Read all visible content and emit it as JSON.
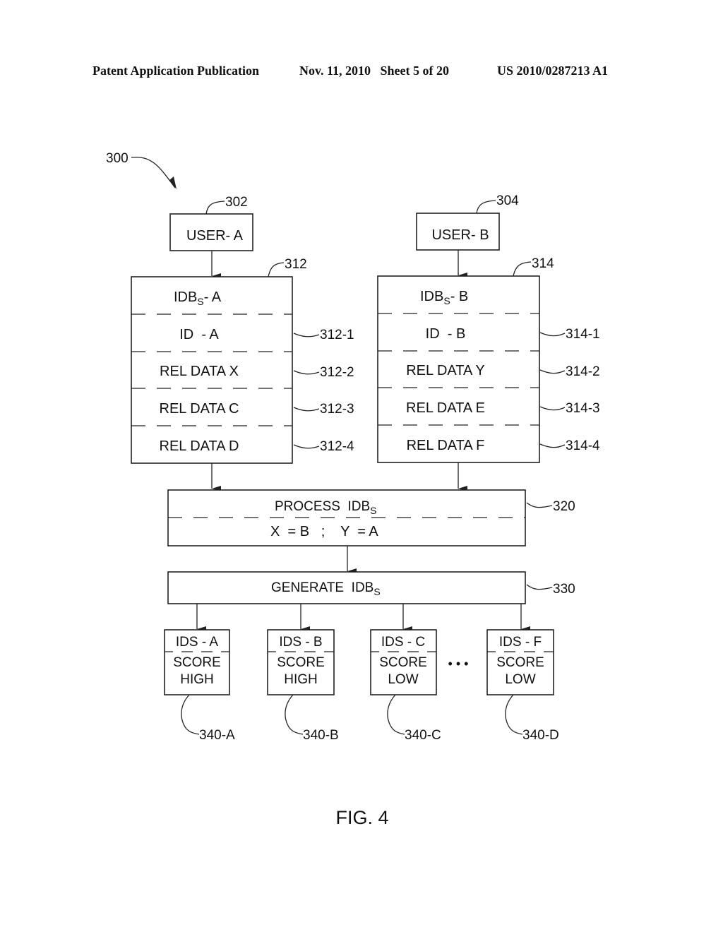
{
  "header": {
    "publication": "Patent Application Publication",
    "date_sheet": "Nov. 11, 2010   Sheet 5 of 20",
    "patent_number": "US 2010/0287213 A1"
  },
  "figure": {
    "caption": "FIG. 4",
    "overall_ref": "300",
    "users": [
      {
        "ref": "302",
        "label": "USER- A"
      },
      {
        "ref": "304",
        "label": "USER- B"
      }
    ],
    "idbs": [
      {
        "ref": "312",
        "title": "IDB",
        "title_sub": "S",
        "title_suffix": "- A",
        "rows": [
          {
            "label": "ID  - A",
            "ref": "312-1"
          },
          {
            "label": "REL DATA X",
            "ref": "312-2"
          },
          {
            "label": "REL DATA C",
            "ref": "312-3"
          },
          {
            "label": "REL DATA D",
            "ref": "312-4"
          }
        ]
      },
      {
        "ref": "314",
        "title": "IDB",
        "title_sub": "S",
        "title_suffix": "- B",
        "rows": [
          {
            "label": "ID  - B",
            "ref": "314-1"
          },
          {
            "label": "REL DATA Y",
            "ref": "314-2"
          },
          {
            "label": "REL DATA E",
            "ref": "314-3"
          },
          {
            "label": "REL DATA F",
            "ref": "314-4"
          }
        ]
      }
    ],
    "process": {
      "ref": "320",
      "title": "PROCESS  IDB",
      "title_sub": "S",
      "rule": "X  = B   ;    Y  = A"
    },
    "generate": {
      "ref": "330",
      "title": "GENERATE  IDB",
      "title_sub": "S"
    },
    "outputs": [
      {
        "ref": "340-A",
        "id": "IDS - A",
        "score": "SCORE",
        "level": "HIGH"
      },
      {
        "ref": "340-B",
        "id": "IDS - B",
        "score": "SCORE",
        "level": "HIGH"
      },
      {
        "ref": "340-C",
        "id": "IDS - C",
        "score": "SCORE",
        "level": "LOW"
      },
      {
        "ref": "340-D",
        "id": "IDS - F",
        "score": "SCORE",
        "level": "LOW"
      }
    ],
    "ellipsis": "• • •"
  }
}
